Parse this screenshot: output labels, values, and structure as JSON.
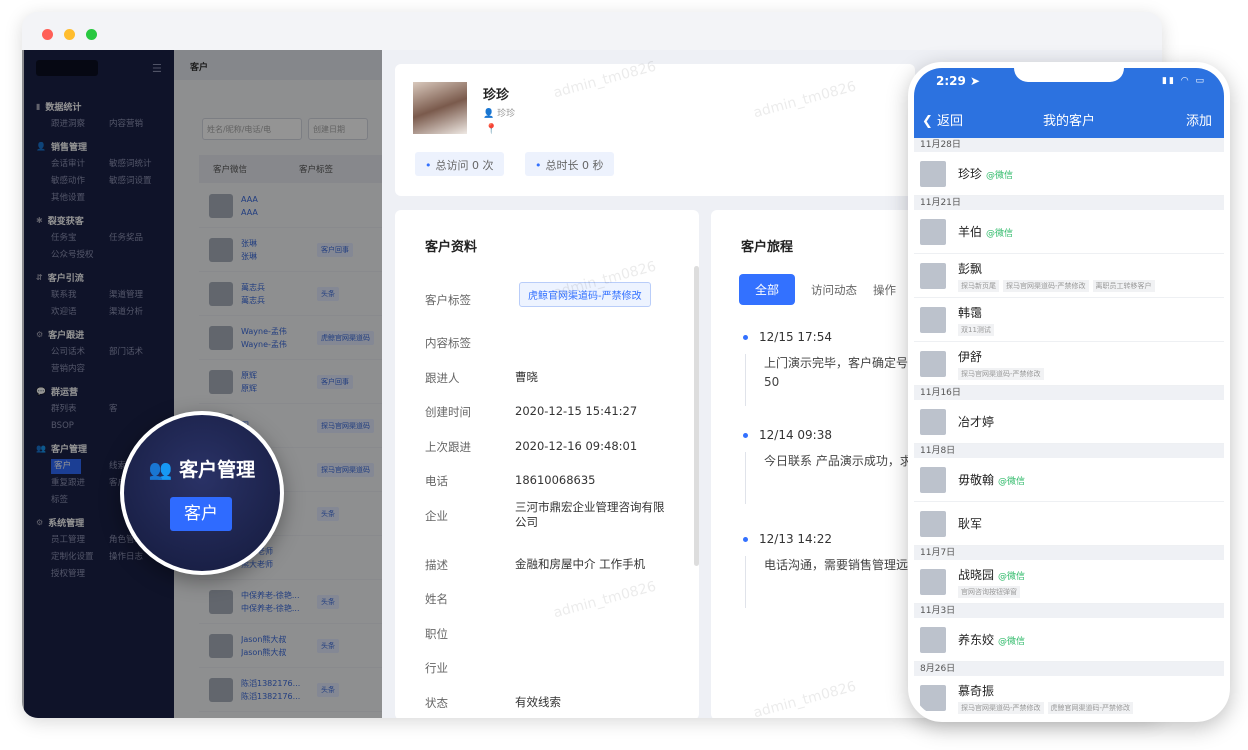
{
  "window": {
    "title": "客户"
  },
  "sidebar": {
    "groups": [
      {
        "title": "数据统计",
        "items": [
          "跟进洞察",
          "内容营销"
        ]
      },
      {
        "title": "销售管理",
        "items": [
          "会话审计",
          "敏感词统计",
          "敏感动作",
          "敏感词设置",
          "其他设置"
        ]
      },
      {
        "title": "裂变获客",
        "items": [
          "任务宝",
          "任务奖品",
          "公众号授权"
        ]
      },
      {
        "title": "客户引流",
        "items": [
          "联系我",
          "渠道管理",
          "欢迎语",
          "渠道分析"
        ]
      },
      {
        "title": "客户跟进",
        "items": [
          "公司话术",
          "部门话术",
          "营销内容"
        ]
      },
      {
        "title": "群运营",
        "items": [
          "群列表",
          "客",
          "BSOP"
        ]
      },
      {
        "title": "客户管理",
        "items": [
          "客户",
          "线索",
          "重复跟进",
          "客户字段",
          "标签"
        ]
      },
      {
        "title": "系统管理",
        "items": [
          "员工管理",
          "角色管理",
          "定制化设置",
          "操作日志",
          "授权管理"
        ]
      }
    ],
    "active": "客户"
  },
  "list": {
    "filters": [
      "姓名/昵称/电话/电",
      "创建日期"
    ],
    "columns": [
      "客户微信",
      "客户标签"
    ],
    "rows": [
      {
        "name1": "AAA",
        "name2": "AAA",
        "tag": ""
      },
      {
        "name1": "张琳",
        "name2": "张琳",
        "tag": "客户回事"
      },
      {
        "name1": "萬志兵",
        "name2": "萬志兵",
        "tag": "头条"
      },
      {
        "name1": "Wayne-孟伟",
        "name2": "Wayne-孟伟",
        "tag": "虎鲸官网渠道码"
      },
      {
        "name1": "原辉",
        "name2": "原辉",
        "tag": "客户回事"
      },
      {
        "name1": "田",
        "name2": "",
        "tag": "探马官网渠道码"
      },
      {
        "name1": "",
        "name2": "",
        "tag": "探马官网渠道码"
      },
      {
        "name1": "",
        "name2": "",
        "tag": "头条"
      },
      {
        "name1": "熊大老师",
        "name2": "熊大老师",
        "tag": ""
      },
      {
        "name1": "中保养老-徐艳...",
        "name2": "中保养老-徐艳...",
        "tag": "头条"
      },
      {
        "name1": "Jason熊大叔",
        "name2": "Jason熊大叔",
        "tag": "头条"
      },
      {
        "name1": "陈滔1382176...",
        "name2": "陈滔1382176...",
        "tag": "头条"
      }
    ]
  },
  "popup": {
    "title": "客户管理",
    "button": "客户"
  },
  "profile": {
    "name": "珍珍",
    "username": "珍珍",
    "visits_label": "总访问",
    "visits": "0 次",
    "duration_label": "总时长",
    "duration": "0 秒"
  },
  "info": {
    "title": "客户资料",
    "fields": [
      {
        "label": "客户标签",
        "value": ""
      },
      {
        "label": "内容标签",
        "value": ""
      },
      {
        "label": "跟进人",
        "value": "曹晓"
      },
      {
        "label": "创建时间",
        "value": "2020-12-15 15:41:27"
      },
      {
        "label": "上次跟进",
        "value": "2020-12-16 09:48:01"
      },
      {
        "label": "电话",
        "value": "18610068635"
      },
      {
        "label": "企业",
        "value": "三河市鼎宏企业管理咨询有限公司"
      },
      {
        "label": "描述",
        "value": "金融和房屋中介 工作手机"
      },
      {
        "label": "姓名",
        "value": ""
      },
      {
        "label": "职位",
        "value": ""
      },
      {
        "label": "行业",
        "value": ""
      },
      {
        "label": "状态",
        "value": "有效线索"
      }
    ],
    "tag": "虎鲸官网渠道码-严禁修改"
  },
  "journey": {
    "title": "客户旅程",
    "tabs": [
      "全部",
      "访问动态",
      "操作"
    ],
    "events": [
      {
        "date": "12/15  17:54",
        "text": "上门演示完毕，客户确定号，未来的增购潜力在50"
      },
      {
        "date": "12/14 09:38",
        "text": "今日联系 产品演示成功，求上门演示"
      },
      {
        "date": "12/13 14:22",
        "text": "电话沟通，需要销售管理远程演示"
      }
    ]
  },
  "phone": {
    "time": "2:29",
    "back": "返回",
    "title": "我的客户",
    "add": "添加",
    "wechat": "@微信",
    "sections": [
      {
        "date": "11月28日",
        "people": [
          {
            "name": "珍珍",
            "wx": true,
            "tags": []
          }
        ]
      },
      {
        "date": "11月21日",
        "people": [
          {
            "name": "羊伯",
            "wx": true,
            "tags": []
          },
          {
            "name": "彭飘",
            "wx": false,
            "tags": [
              "探马新页尾",
              "探马官网渠道码-严禁修改",
              "离职员工转移客户"
            ]
          },
          {
            "name": "韩霭",
            "wx": false,
            "tags": [
              "双11测试"
            ]
          },
          {
            "name": "伊舒",
            "wx": false,
            "tags": [
              "探马官网渠道码-严禁修改"
            ]
          }
        ]
      },
      {
        "date": "11月16日",
        "people": [
          {
            "name": "冶才婷",
            "wx": false,
            "tags": []
          }
        ]
      },
      {
        "date": "11月8日",
        "people": [
          {
            "name": "毋敬翰",
            "wx": true,
            "tags": []
          },
          {
            "name": "耿军",
            "wx": false,
            "tags": []
          }
        ]
      },
      {
        "date": "11月7日",
        "people": [
          {
            "name": "战晓园",
            "wx": true,
            "tags": [
              "官网咨询按钮弹窗"
            ]
          }
        ]
      },
      {
        "date": "11月3日",
        "people": [
          {
            "name": "养东姣",
            "wx": true,
            "tags": []
          }
        ]
      },
      {
        "date": "8月26日",
        "people": [
          {
            "name": "慕奇振",
            "wx": false,
            "tags": [
              "探马官网渠道码-严禁修改",
              "虎鲸官网渠道码-严禁修改"
            ]
          }
        ]
      }
    ]
  }
}
